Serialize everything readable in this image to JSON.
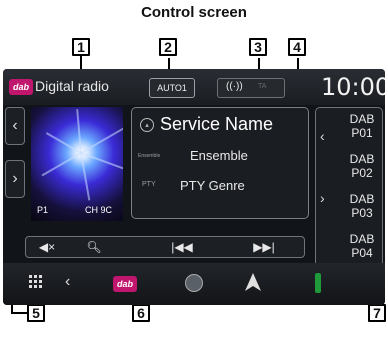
{
  "heading": "Control screen",
  "callouts": {
    "c1": "1",
    "c2": "2",
    "c3": "3",
    "c4": "4",
    "c5": "5",
    "c6": "6",
    "c7": "7"
  },
  "top_bar": {
    "logo": "dab",
    "source_title": "Digital radio",
    "auto_badge": "AUTO1",
    "signal_icon": "((·))",
    "ta_label": "TA",
    "clock": "10:00"
  },
  "left_panel": {
    "prev_arrow": "‹",
    "next_arrow": "›",
    "preset_label": "P1",
    "channel_label": "CH 9C"
  },
  "info": {
    "service_name": "Service Name",
    "ensemble_label": "Ensemble",
    "ensemble_value": "Ensemble",
    "pty_label": "PTY",
    "pty_value": "PTY Genre"
  },
  "transport": {
    "mute": "◀×",
    "search": "🔍︎",
    "prev": "|◀◀",
    "next": "▶▶|"
  },
  "presets": {
    "up_arrow": "‹",
    "down_arrow": "›",
    "items": [
      {
        "band": "DAB",
        "num": "P01"
      },
      {
        "band": "DAB",
        "num": "P02"
      },
      {
        "band": "DAB",
        "num": "P03"
      },
      {
        "band": "DAB",
        "num": "P04"
      }
    ]
  },
  "bottom_bar": {
    "back": "‹",
    "dab_logo": "dab"
  },
  "colors": {
    "dab_brand": "#c0166e",
    "screen_bg": "#111418",
    "green_tab": "#1e9a3a"
  }
}
